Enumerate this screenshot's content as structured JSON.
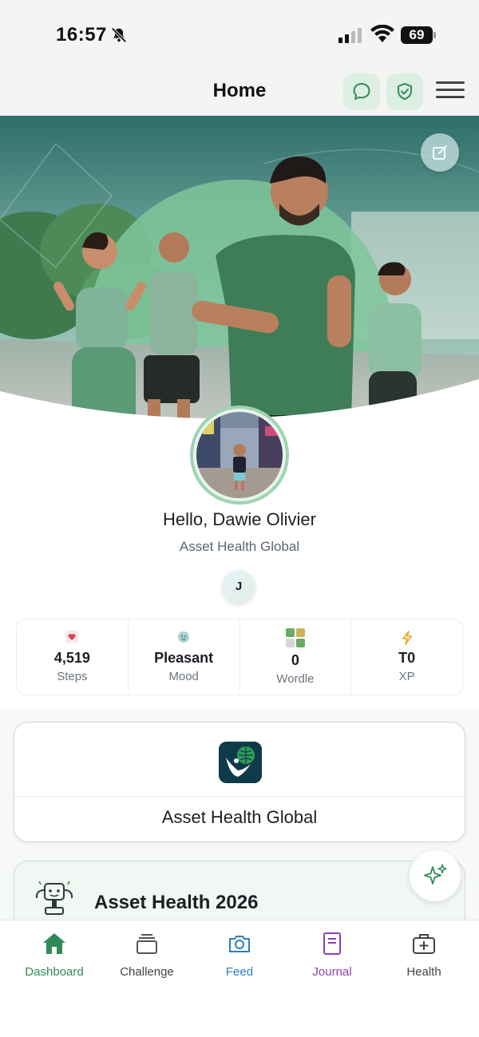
{
  "status_bar": {
    "time": "16:57",
    "battery": "69"
  },
  "header": {
    "title": "Home"
  },
  "profile": {
    "greeting": "Hello, Dawie Olivier",
    "organization": "Asset Health Global",
    "initial": "J"
  },
  "stats": [
    {
      "icon": "heart-icon",
      "value": "4,519",
      "label": "Steps"
    },
    {
      "icon": "mood-face-icon",
      "value": "Pleasant",
      "label": "Mood"
    },
    {
      "icon": "wordle-grid-icon",
      "value": "0",
      "label": "Wordle"
    },
    {
      "icon": "lightning-icon",
      "value": "T0",
      "label": "XP"
    }
  ],
  "org_card": {
    "name": "Asset Health Global"
  },
  "challenge_card": {
    "title": "Asset Health 2026"
  },
  "tabs": [
    {
      "label": "Dashboard",
      "icon": "home-icon",
      "color": "#2e8b57"
    },
    {
      "label": "Challenge",
      "icon": "stack-icon",
      "color": "#555555"
    },
    {
      "label": "Feed",
      "icon": "camera-icon",
      "color": "#2a7fc0"
    },
    {
      "label": "Journal",
      "icon": "journal-icon",
      "color": "#8a3fb0"
    },
    {
      "label": "Health",
      "icon": "medical-bag-icon",
      "color": "#444444"
    }
  ],
  "colors": {
    "accent": "#2e8b57",
    "hero_green": "#7fc59a",
    "card_border": "#cfd8d4"
  }
}
